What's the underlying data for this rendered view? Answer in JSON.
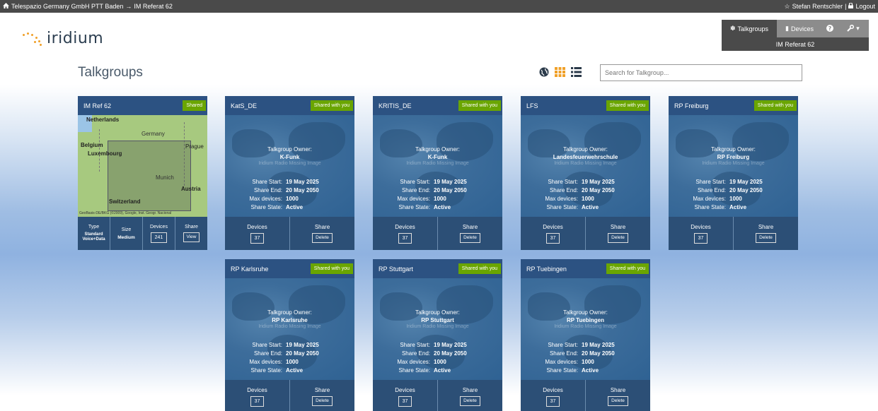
{
  "topbar": {
    "breadcrumb_org": "Telespazio Germany GmbH PTT Baden",
    "breadcrumb_arrow": "→",
    "breadcrumb_current": "IM Referat 62",
    "user": "Stefan Rentschler",
    "separator": "|",
    "logout": "Logout"
  },
  "logo": {
    "text": "iridium",
    "accent": "#f0a028"
  },
  "nav": {
    "talkgroups": "Talkgroups",
    "devices": "Devices",
    "sub_label": "IM Referat 62"
  },
  "page": {
    "title": "Talkgroups",
    "search_placeholder": "Search for Talkgroup..."
  },
  "labels": {
    "owner": "Talkgroup Owner:",
    "missing_image": "Iridium Radio Missing Image",
    "share_start": "Share Start:",
    "share_end": "Share End:",
    "max_devices": "Max devices:",
    "share_state": "Share State:",
    "devices": "Devices",
    "share": "Share",
    "type": "Type",
    "size": "Size",
    "delete": "Delete",
    "view": "View"
  },
  "own_card": {
    "name": "IM Ref 62",
    "badge": "Shared",
    "type_line1": "Standard",
    "type_line2": "Voice+Data",
    "size": "Medium",
    "devices": "241",
    "map_labels": {
      "netherlands": "Netherlands",
      "germany": "Germany",
      "belgium": "Belgium",
      "luxembourg": "Luxembourg",
      "prague": "Prague",
      "munich": "Munich",
      "austria": "Austria",
      "switzerland": "Switzerland",
      "credit": "GeoBasis-DE/BKG (©2009), Google, Inst. Geogr. Nacional"
    }
  },
  "shared_cards": [
    {
      "name": "KatS_DE",
      "badge": "Shared with you",
      "owner": "K-Funk",
      "start": "19 May 2025",
      "end": "20 May 2050",
      "max": "1000",
      "state": "Active",
      "devices": "37"
    },
    {
      "name": "KRITIS_DE",
      "badge": "Shared with you",
      "owner": "K-Funk",
      "start": "19 May 2025",
      "end": "20 May 2050",
      "max": "1000",
      "state": "Active",
      "devices": "37"
    },
    {
      "name": "LFS",
      "badge": "Shared with you",
      "owner": "Landesfeuerwehrschule",
      "start": "19 May 2025",
      "end": "20 May 2050",
      "max": "1000",
      "state": "Active",
      "devices": "37"
    },
    {
      "name": "RP Freiburg",
      "badge": "Shared with you",
      "owner": "RP Freiburg",
      "start": "19 May 2025",
      "end": "20 May 2050",
      "max": "1000",
      "state": "Active",
      "devices": "37"
    },
    {
      "name": "RP Karlsruhe",
      "badge": "Shared with you",
      "owner": "RP Karlsruhe",
      "start": "19 May 2025",
      "end": "20 May 2050",
      "max": "1000",
      "state": "Active",
      "devices": "37"
    },
    {
      "name": "RP Stuttgart",
      "badge": "Shared with you",
      "owner": "RP Stuttgart",
      "start": "19 May 2025",
      "end": "20 May 2050",
      "max": "1000",
      "state": "Active",
      "devices": "37"
    },
    {
      "name": "RP Tuebingen",
      "badge": "Shared with you",
      "owner": "RP Tuebingen",
      "start": "19 May 2025",
      "end": "20 May 2050",
      "max": "1000",
      "state": "Active",
      "devices": "37"
    }
  ],
  "colors": {
    "topbar": "#4a4a4a",
    "card": "#2c5a84",
    "badge": "#6aa500",
    "grid_icon": "#f0a028"
  }
}
